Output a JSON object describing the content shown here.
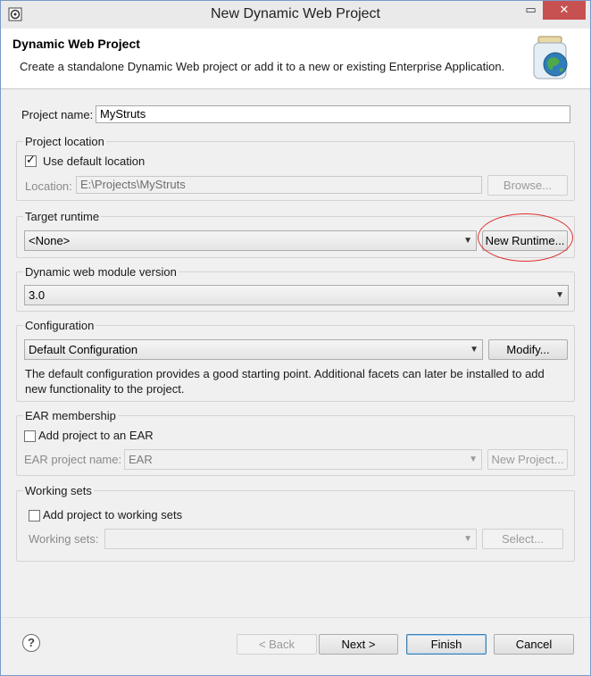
{
  "window": {
    "title": "New Dynamic Web Project",
    "maximize_glyph": "▭",
    "close_glyph": "✕"
  },
  "banner": {
    "title": "Dynamic Web Project",
    "description": "Create a standalone Dynamic Web project or add it to a new or existing Enterprise Application."
  },
  "project_name": {
    "label": "Project name:",
    "value": "MyStruts"
  },
  "project_location": {
    "group_label": "Project location",
    "use_default_label": "Use default location",
    "use_default_checked": true,
    "location_label": "Location:",
    "location_value": "E:\\Projects\\MyStruts",
    "browse_label": "Browse..."
  },
  "target_runtime": {
    "group_label": "Target runtime",
    "selected": "<None>",
    "new_runtime_label": "New Runtime..."
  },
  "module_version": {
    "group_label": "Dynamic web module version",
    "selected": "3.0"
  },
  "configuration": {
    "group_label": "Configuration",
    "selected": "Default Configuration",
    "modify_label": "Modify...",
    "description_line1": "The default configuration provides a good starting point. Additional facets can later be installed to add",
    "description_line2": "new functionality to the project."
  },
  "ear_membership": {
    "group_label": "EAR membership",
    "add_label": "Add project to an EAR",
    "add_checked": false,
    "ear_name_label": "EAR project name:",
    "ear_name_value": "EAR",
    "new_project_label": "New Project..."
  },
  "working_sets": {
    "group_label": "Working sets",
    "add_label": "Add project to working sets",
    "add_checked": false,
    "sets_label": "Working sets:",
    "sets_value": "",
    "select_label": "Select..."
  },
  "footer": {
    "help_glyph": "?",
    "back_label": "< Back",
    "next_label": "Next >",
    "finish_label": "Finish",
    "cancel_label": "Cancel"
  },
  "colors": {
    "annotation_circle": "#e03030",
    "close_button": "#c75050"
  }
}
